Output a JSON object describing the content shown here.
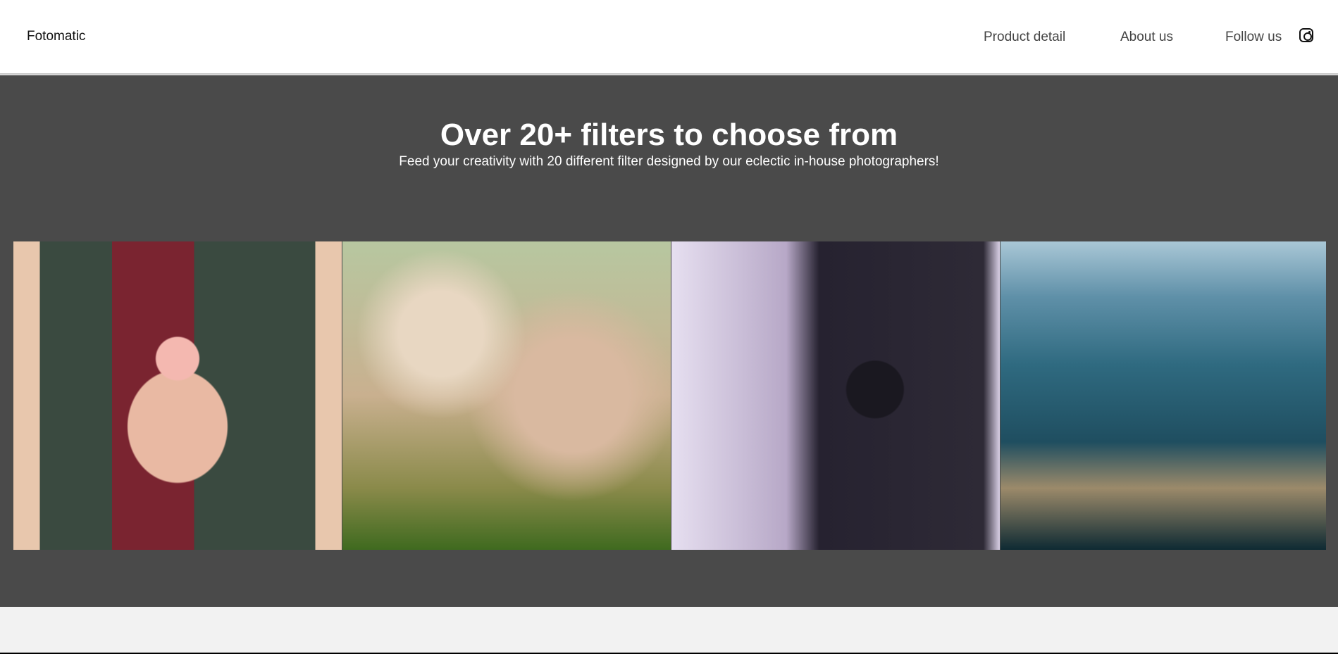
{
  "header": {
    "brand": "Fotomatic",
    "nav": [
      "Product detail",
      "About us",
      "Follow us"
    ],
    "social_icon": "instagram-icon"
  },
  "hero": {
    "title": "Over 20+ filters to choose from",
    "subtitle": "Feed your creativity with 20 different filter designed by our eclectic in-house photographers!",
    "background": "#4a4a4a"
  },
  "gallery": {
    "images": [
      "flower-photo",
      "blossom-tree-photo",
      "camera-photographer-photo",
      "mountain-valley-photo"
    ]
  }
}
